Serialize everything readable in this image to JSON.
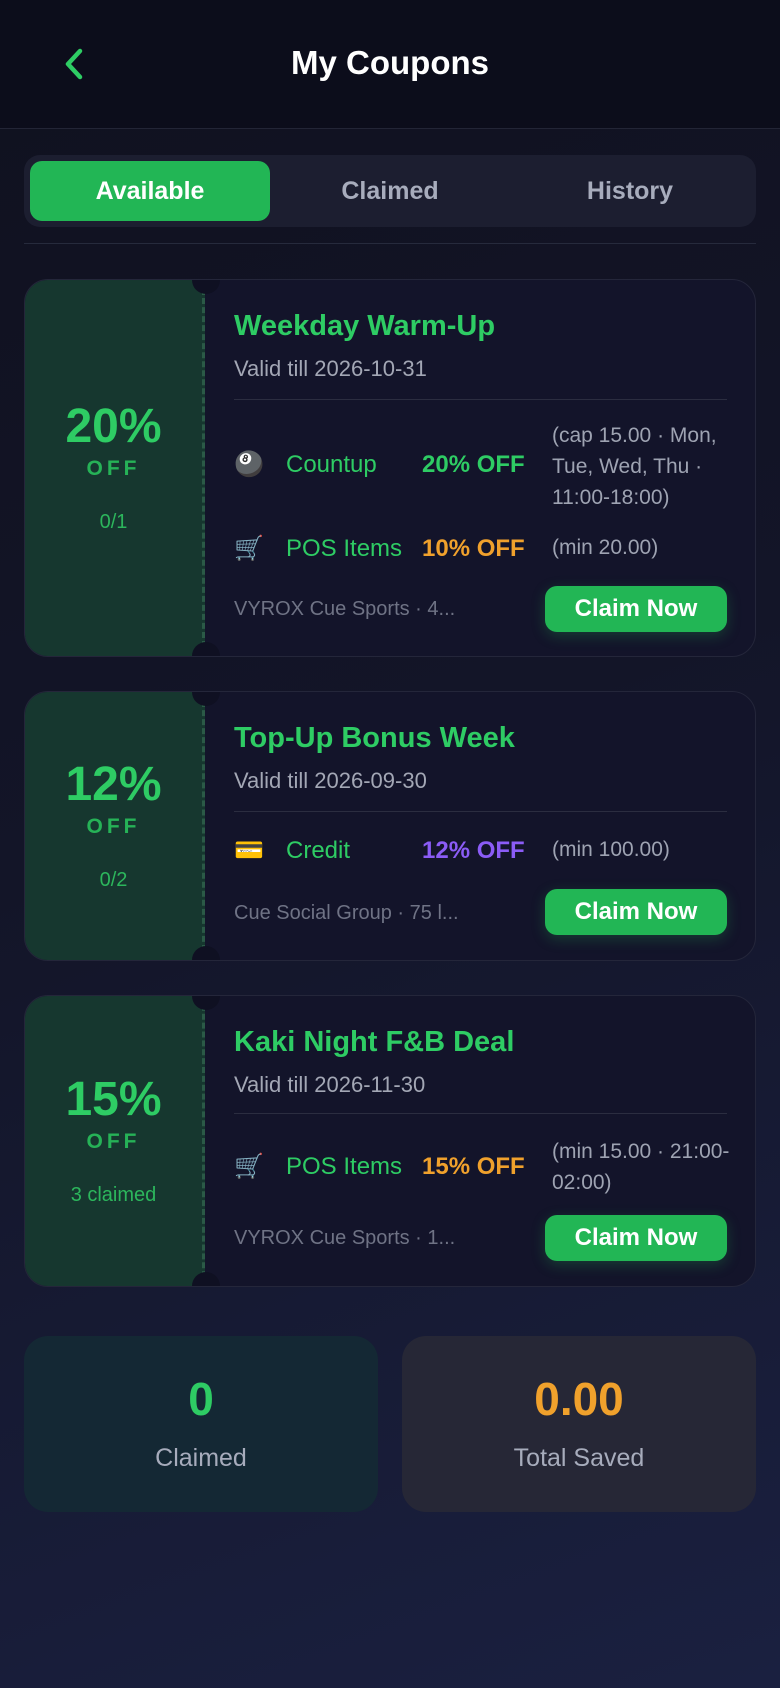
{
  "header": {
    "title": "My Coupons",
    "back_icon": "chevron-left-icon"
  },
  "tabs": [
    {
      "label": "Available",
      "active": true
    },
    {
      "label": "Claimed",
      "active": false
    },
    {
      "label": "History",
      "active": false
    }
  ],
  "coupons": [
    {
      "percent": "20%",
      "off_label": "OFF",
      "count": "0/1",
      "title": "Weekday Warm-Up",
      "valid": "Valid till 2026-10-31",
      "items": [
        {
          "icon": "billiard-ball-icon",
          "glyph": "🎱",
          "name": "Countup",
          "off": "20% OFF",
          "off_color": "#2ecc64",
          "note": "(cap 15.00 · Mon, Tue, Wed, Thu · 11:00-18:00)"
        },
        {
          "icon": "cart-icon",
          "glyph": "🛒",
          "name": "POS Items",
          "off": "10% OFF",
          "off_color": "#f0a12c",
          "note": "(min 20.00)"
        }
      ],
      "venue": "VYROX Cue Sports · 4...",
      "button": "Claim Now"
    },
    {
      "percent": "12%",
      "off_label": "OFF",
      "count": "0/2",
      "title": "Top-Up Bonus Week",
      "valid": "Valid till 2026-09-30",
      "items": [
        {
          "icon": "credit-card-icon",
          "glyph": "💳",
          "name": "Credit",
          "off": "12% OFF",
          "off_color": "#8b5cf6",
          "note": "(min 100.00)"
        }
      ],
      "venue": "Cue Social Group · 75 l...",
      "button": "Claim Now"
    },
    {
      "percent": "15%",
      "off_label": "OFF",
      "count": "3 claimed",
      "title": "Kaki Night F&B Deal",
      "valid": "Valid till 2026-11-30",
      "items": [
        {
          "icon": "cart-icon",
          "glyph": "🛒",
          "name": "POS Items",
          "off": "15% OFF",
          "off_color": "#f0a12c",
          "note": "(min 15.00 · 21:00-02:00)"
        }
      ],
      "venue": "VYROX Cue Sports · 1...",
      "button": "Claim Now"
    }
  ],
  "summary": {
    "claimed_value": "0",
    "claimed_label": "Claimed",
    "saved_value": "0.00",
    "saved_label": "Total Saved"
  },
  "colors": {
    "accent_green": "#22b655",
    "orange": "#f0a12c",
    "purple": "#8b5cf6"
  }
}
